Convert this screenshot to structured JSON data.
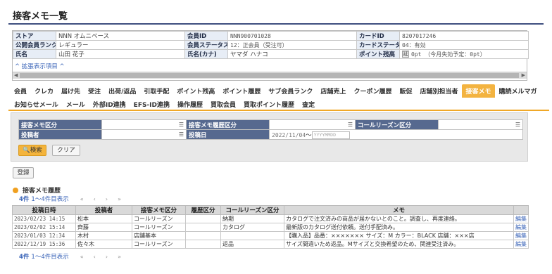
{
  "page": {
    "title": "接客メモ一覧"
  },
  "customer": {
    "rows": [
      [
        {
          "label": "ストア",
          "value": "NNN オムニベース"
        },
        {
          "label": "会員ID",
          "value": "NNN900701028"
        },
        {
          "label": "カードID",
          "value": "8207017246"
        }
      ],
      [
        {
          "label": "公開会員ランク",
          "value": "レギュラー"
        },
        {
          "label": "会員ステータス",
          "value": "12：正会員（受注可）"
        },
        {
          "label": "カードステータス",
          "value": "04：有効"
        }
      ],
      [
        {
          "label": "氏名",
          "value": "山田 花子"
        },
        {
          "label": "氏名(カナ)",
          "value": "ヤマダ ハナコ"
        },
        {
          "label": "ポイント残高",
          "value": "0pt （今月失効予定：0pt）"
        }
      ]
    ],
    "points_icon": "延",
    "expand_link": "拡張表示項目"
  },
  "tabs": {
    "row1": [
      "会員",
      "クレカ",
      "届け先",
      "受注",
      "出荷/返品",
      "引取手配",
      "ポイント残高",
      "ポイント履歴",
      "サブ会員ランク",
      "店舗売上",
      "クーポン履歴",
      "販促",
      "店舗別担当者",
      "接客メモ",
      "購読メルマガ"
    ],
    "row2": [
      "お知らせメール",
      "メール",
      "外部ID連携",
      "EFS-ID連携",
      "操作履歴",
      "買取会員",
      "買取ポイント履歴",
      "査定"
    ],
    "active": "接客メモ"
  },
  "search": {
    "fields": {
      "memo_type": "接客メモ区分",
      "memo_history_type": "接客メモ履歴区分",
      "call_reason_type": "コールリーズン区分",
      "poster": "投稿者",
      "post_date": "投稿日"
    },
    "date_from": "2022/11/04",
    "date_sep": "〜",
    "date_to_placeholder": "YYYYMMDD",
    "search_button": "検索",
    "clear_button": "クリア"
  },
  "register_button": "登録",
  "history": {
    "title": "接客メモ履歴",
    "count": "4件",
    "range": "1～4件目表示",
    "bottom_count": "4件",
    "bottom_range": "1～4件目表示",
    "columns": [
      "投稿日時",
      "投稿者",
      "接客メモ区分",
      "履歴区分",
      "コールリーズン区分",
      "メモ",
      ""
    ],
    "rows": [
      [
        "2023/02/23 14:15",
        "松本",
        "コールリーズン",
        "",
        "納期",
        "カタログで注文済みの商品が届かないとのこと。調査し、再度連絡。",
        "編集"
      ],
      [
        "2023/02/02 15:14",
        "齊藤",
        "コールリーズン",
        "",
        "カタログ",
        "最新版のカタログ送付依頼。送付手配済み。",
        "編集"
      ],
      [
        "2023/01/03 12:34",
        "木村",
        "店舗基本",
        "",
        "",
        "【購入品】品番：××××××× サイズ：M カラー：BLACK 店舗：×××店",
        "編集"
      ],
      [
        "2022/12/19 15:36",
        "佐々木",
        "コールリーズン",
        "",
        "返品",
        "サイズ間違いため返品。Mサイズと交換希望のため、関連受注済み。",
        "編集"
      ]
    ]
  },
  "pager_nav": [
    "«",
    "‹",
    "›",
    "»"
  ]
}
